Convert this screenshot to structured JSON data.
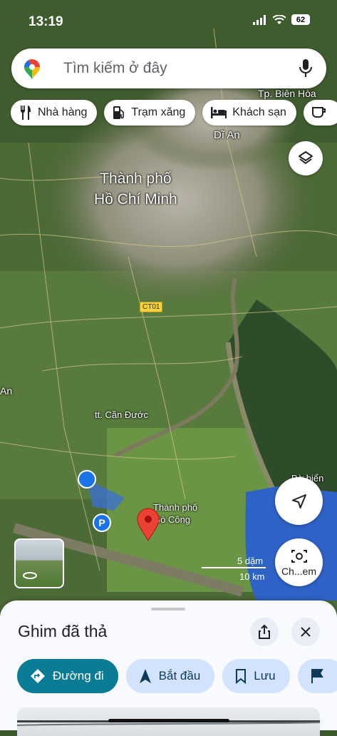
{
  "status_bar": {
    "time": "13:19",
    "battery": "62"
  },
  "search": {
    "placeholder": "Tìm kiếm ở đây"
  },
  "categories": [
    {
      "label": "Nhà hàng",
      "icon": "fork-knife-icon"
    },
    {
      "label": "Trạm xăng",
      "icon": "gas-station-icon"
    },
    {
      "label": "Khách sạn",
      "icon": "bed-icon"
    }
  ],
  "map_labels": {
    "city_line1": "Thành phố",
    "city_line2": "Hồ Chí Minh",
    "can_duoc": "tt. Cần Đước",
    "go_cong_line1": "Thành phố",
    "go_cong_line2": "Gò Công",
    "di_an": "Dĩ An",
    "bien_hoa": "Tp. Biên Hòa",
    "an": "An",
    "bien_r1": "Bờ biển",
    "bien_r2": "Hải",
    "road": "CT01"
  },
  "scale": {
    "label1": "5 dặm",
    "label2": "10 km"
  },
  "lens_label": "Ch...em",
  "sheet": {
    "title": "Ghim đã thả",
    "actions": [
      {
        "label": "Đường đi",
        "icon": "directions-icon"
      },
      {
        "label": "Bắt đầu",
        "icon": "navigation-icon"
      },
      {
        "label": "Lưu",
        "icon": "bookmark-icon"
      }
    ]
  },
  "colors": {
    "water": "#2f62c7",
    "pin": "#ea4335",
    "primary_action": "#0b7c96",
    "location_dot": "#1a73e8"
  }
}
